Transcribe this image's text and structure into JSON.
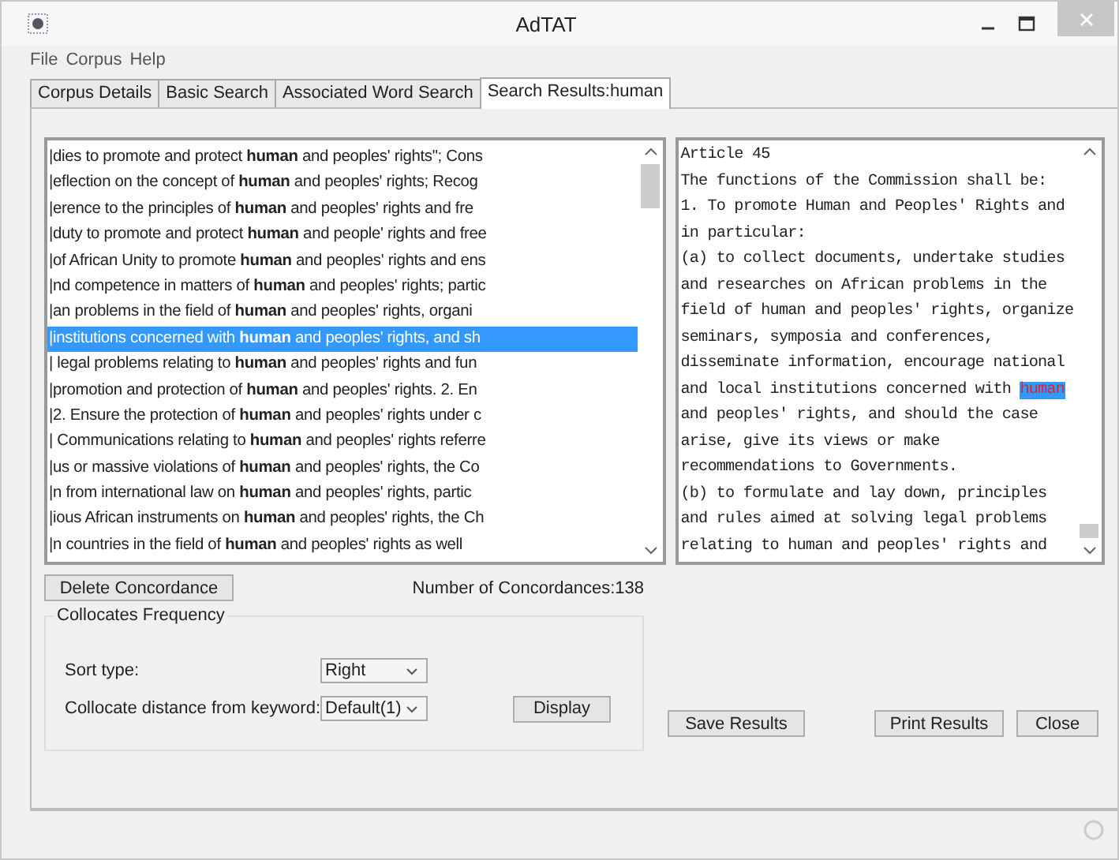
{
  "window": {
    "title": "AdTAT"
  },
  "menu": [
    "File",
    "Corpus",
    "Help"
  ],
  "tabs": [
    {
      "label": "Corpus Details",
      "selected": false
    },
    {
      "label": "Basic Search",
      "selected": false
    },
    {
      "label": "Associated Word Search",
      "selected": false
    },
    {
      "label": "Search Results:human",
      "selected": true
    }
  ],
  "concordances": [
    {
      "text": "|dies to promote and protect **human** and peoples' rights\"; Cons",
      "selected": false
    },
    {
      "text": "|eflection on the concept of **human** and peoples' rights; Recog",
      "selected": false
    },
    {
      "text": "|erence to the principles of **human** and peoples' rights and fre",
      "selected": false
    },
    {
      "text": "|duty to promote and protect **human** and people' rights and free",
      "selected": false
    },
    {
      "text": "|of African Unity to promote **human** and peoples' rights and ens",
      "selected": false
    },
    {
      "text": "|nd competence in matters of **human** and peoples' rights; partic",
      "selected": false
    },
    {
      "text": "|an problems in the field of **human** and peoples' rights, organi",
      "selected": false
    },
    {
      "text": "|institutions concerned with **human** and peoples' rights, and sh",
      "selected": true
    },
    {
      "text": "| legal problems relating to **human** and peoples' rights and fun",
      "selected": false
    },
    {
      "text": "|promotion and protection of **human** and peoples' rights. 2. En",
      "selected": false
    },
    {
      "text": "|2. Ensure the protection of **human** and peoples' rights under c",
      "selected": false
    },
    {
      "text": "| Communications relating to **human** and peoples' rights referre",
      "selected": false
    },
    {
      "text": "|us or massive violations of **human** and peoples' rights, the Co",
      "selected": false
    },
    {
      "text": "|n from international law on **human** and peoples' rights, partic",
      "selected": false
    },
    {
      "text": "|ious African instruments on **human** and peoples' rights, the Ch",
      "selected": false
    },
    {
      "text": "|n countries in the field of **human** and peoples' rights as well",
      "selected": false
    }
  ],
  "document_lines": [
    {
      "text": "Article 45"
    },
    {
      "text": "The functions of the Commission shall be:"
    },
    {
      "text": "1. To promote Human and Peoples' Rights and"
    },
    {
      "text": "in particular:"
    },
    {
      "text": "(a) to collect documents, undertake studies"
    },
    {
      "text": "and researches on African problems in the"
    },
    {
      "text": "field of human and peoples' rights, organize"
    },
    {
      "text": "seminars, symposia and conferences,"
    },
    {
      "text": "disseminate information, encourage national"
    },
    {
      "text": "and local institutions concerned with ",
      "highlight": "human"
    },
    {
      "text": "and peoples' rights, and should the case"
    },
    {
      "text": "arise, give its views or make"
    },
    {
      "text": "recommendations to Governments."
    },
    {
      "text": "(b) to formulate and lay down, principles"
    },
    {
      "text": "and rules aimed at solving legal problems"
    },
    {
      "text": "relating to human and peoples' rights and"
    }
  ],
  "delete_button": "Delete Concordance",
  "concordance_count": "Number of Concordances:138",
  "collocates": {
    "title": "Collocates Frequency",
    "sort_label": "Sort type:",
    "sort_value": "Right",
    "distance_label": "Collocate distance from keyword:",
    "distance_value": "Default(1)",
    "display_button": "Display"
  },
  "buttons": [
    "Save Results",
    "Print Results",
    "Close"
  ]
}
